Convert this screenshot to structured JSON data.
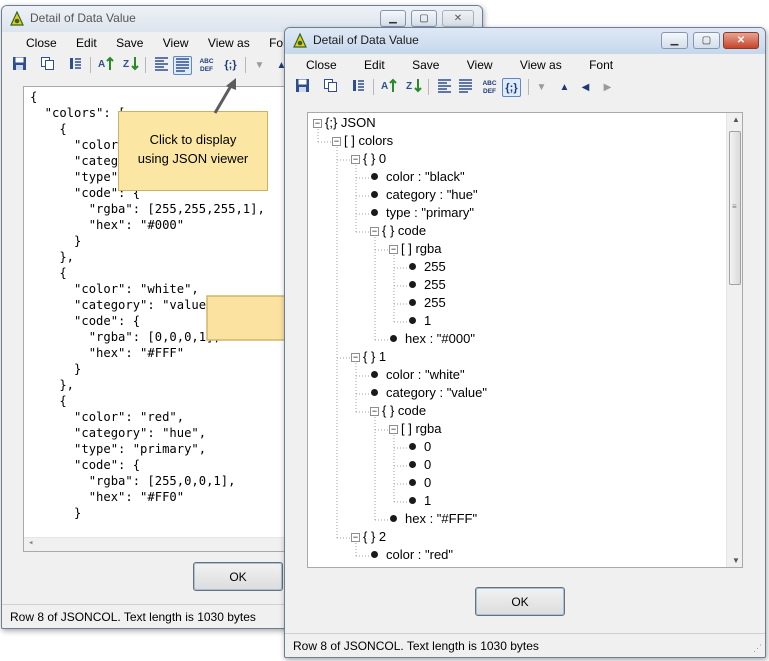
{
  "window_title": "Detail of Data Value",
  "menu": [
    "Close",
    "Edit",
    "Save",
    "View",
    "View as",
    "Font"
  ],
  "back_window": {
    "json_lines": [
      "{",
      "  \"colors\": [",
      "    {",
      "      \"color\": \"b",
      "      \"category",
      "      \"type\": \"pr",
      "      \"code\": {",
      "        \"rgba\": [255,255,255,1],",
      "        \"hex\": \"#000\"",
      "      }",
      "    },",
      "    {",
      "      \"color\": \"white\",",
      "      \"category\": \"value\",",
      "      \"code\": {",
      "        \"rgba\": [0,0,0,1],",
      "        \"hex\": \"#FFF\"",
      "      }",
      "    },",
      "    {",
      "      \"color\": \"red\",",
      "      \"category\": \"hue\",",
      "      \"type\": \"primary\",",
      "      \"code\": {",
      "        \"rgba\": [255,0,0,1],",
      "        \"hex\": \"#FF0\"",
      "      }"
    ],
    "ok_label": "OK",
    "status": "Row 8 of JSONCOL. Text length is 1030 bytes"
  },
  "callout": {
    "line1": "Click to display",
    "line2": "using JSON viewer"
  },
  "front_window": {
    "tree": [
      {
        "label": "{;} JSON",
        "kind": "root"
      },
      {
        "label": "[ ] colors",
        "kind": "array"
      },
      {
        "label": "{ } 0",
        "kind": "object"
      },
      {
        "label": "color : \"black\"",
        "kind": "leaf"
      },
      {
        "label": "category : \"hue\"",
        "kind": "leaf"
      },
      {
        "label": "type : \"primary\"",
        "kind": "leaf"
      },
      {
        "label": "{ } code",
        "kind": "object"
      },
      {
        "label": "[ ] rgba",
        "kind": "array"
      },
      {
        "label": "255",
        "kind": "leaf"
      },
      {
        "label": "255",
        "kind": "leaf"
      },
      {
        "label": "255",
        "kind": "leaf"
      },
      {
        "label": "1",
        "kind": "leaf"
      },
      {
        "label": "hex : \"#000\"",
        "kind": "leaf"
      },
      {
        "label": "{ } 1",
        "kind": "object"
      },
      {
        "label": "color : \"white\"",
        "kind": "leaf"
      },
      {
        "label": "category : \"value\"",
        "kind": "leaf"
      },
      {
        "label": "{ } code",
        "kind": "object"
      },
      {
        "label": "[ ] rgba",
        "kind": "array"
      },
      {
        "label": "0",
        "kind": "leaf"
      },
      {
        "label": "0",
        "kind": "leaf"
      },
      {
        "label": "0",
        "kind": "leaf"
      },
      {
        "label": "1",
        "kind": "leaf"
      },
      {
        "label": "hex : \"#FFF\"",
        "kind": "leaf"
      },
      {
        "label": "{ } 2",
        "kind": "object"
      },
      {
        "label": "color : \"red\"",
        "kind": "leaf"
      }
    ],
    "ok_label": "OK",
    "status": "Row 8 of JSONCOL. Text length is 1030 bytes"
  },
  "toolbar_icons": [
    "save-icon",
    "copy-icon",
    "columns-icon",
    "sort-asc-icon",
    "sort-desc-icon",
    "align-left-icon",
    "align-justify-icon",
    "abc-def-icon",
    "json-view-icon",
    "triangle-down-icon",
    "triangle-up-icon",
    "triangle-left-icon",
    "triangle-right-icon"
  ],
  "toolbar_glyphs": {
    "abc": "ABC\nDEF",
    "json": "{;}"
  },
  "colors": {
    "callout_fill": "#fbe7a3",
    "arrow_fill": "#fbe2a0",
    "bullet": "#1a1a1a"
  }
}
